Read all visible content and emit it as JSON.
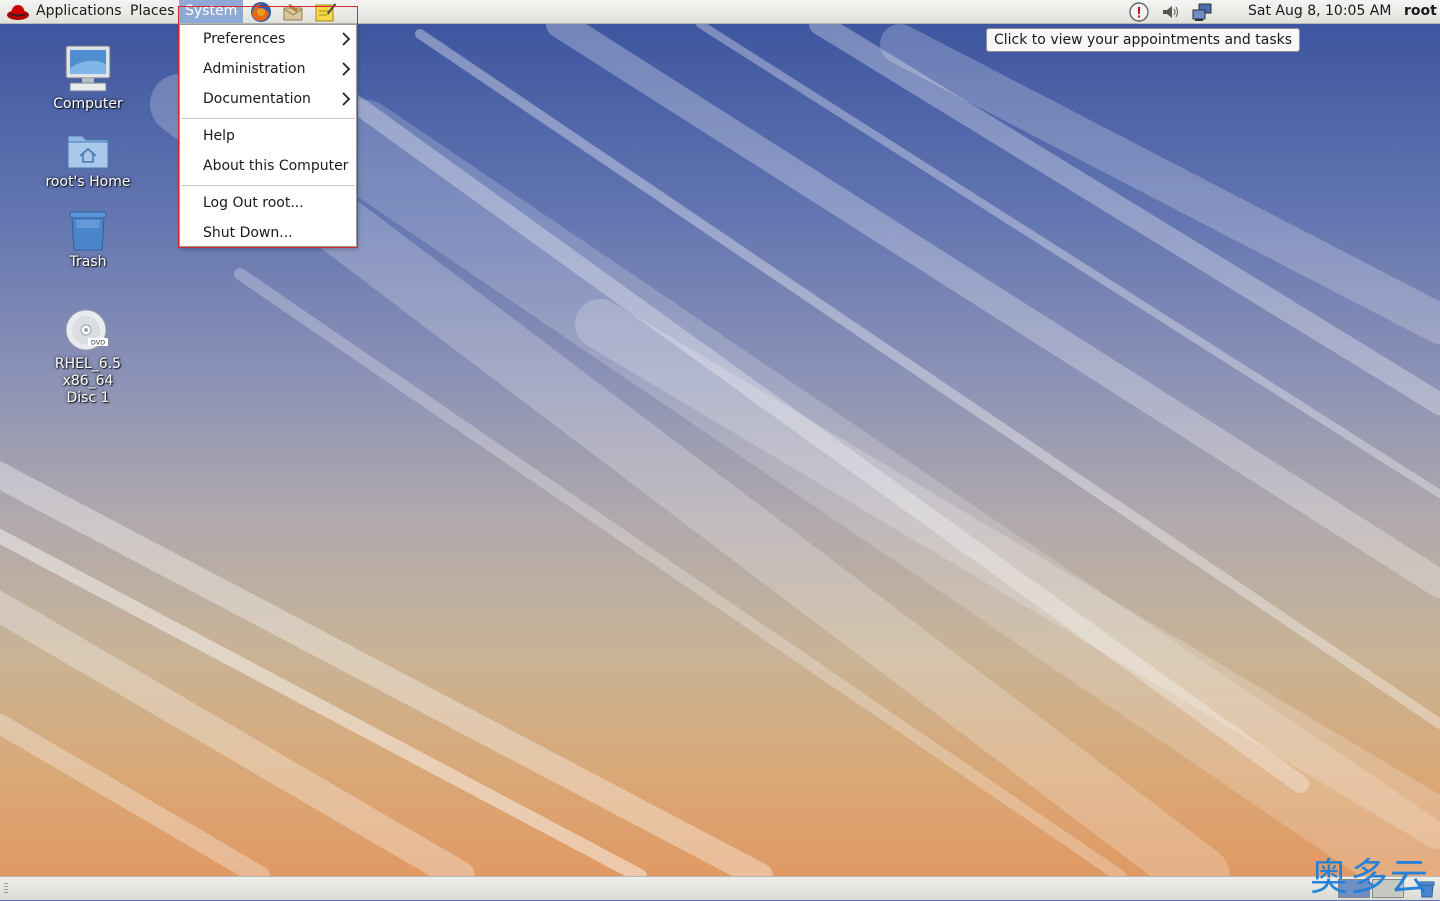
{
  "top_panel": {
    "menus": {
      "applications": "Applications",
      "places": "Places",
      "system": "System"
    },
    "launchers": [
      "firefox-icon",
      "mail-icon",
      "notes-icon"
    ],
    "tray": [
      "update-notifier-icon",
      "volume-icon",
      "network-icon"
    ],
    "clock": "Sat Aug  8, 10:05 AM",
    "user": "root"
  },
  "system_menu": {
    "items": [
      {
        "label": "Preferences",
        "submenu": true
      },
      {
        "label": "Administration",
        "submenu": true
      },
      {
        "label": "Documentation",
        "submenu": true
      },
      {
        "label": "Help",
        "submenu": false
      },
      {
        "label": "About this Computer",
        "submenu": false
      },
      {
        "label": "Log Out root...",
        "submenu": false
      },
      {
        "label": "Shut Down...",
        "submenu": false
      }
    ]
  },
  "tooltip": "Click to view your appointments and tasks",
  "desktop": {
    "icons": [
      {
        "label": "Computer",
        "icon": "computer-icon"
      },
      {
        "label": "root's Home",
        "icon": "home-folder-icon"
      },
      {
        "label": "Trash",
        "icon": "trash-icon"
      },
      {
        "label_line1": "RHEL_6.5 x86_64",
        "label_line2": "Disc 1",
        "icon": "dvd-icon"
      }
    ]
  },
  "watermark": "奥多云",
  "colors": {
    "menu_highlight": "#8fa9d6",
    "annotation": "#d12a2a",
    "watermark": "#1e7fd8"
  }
}
